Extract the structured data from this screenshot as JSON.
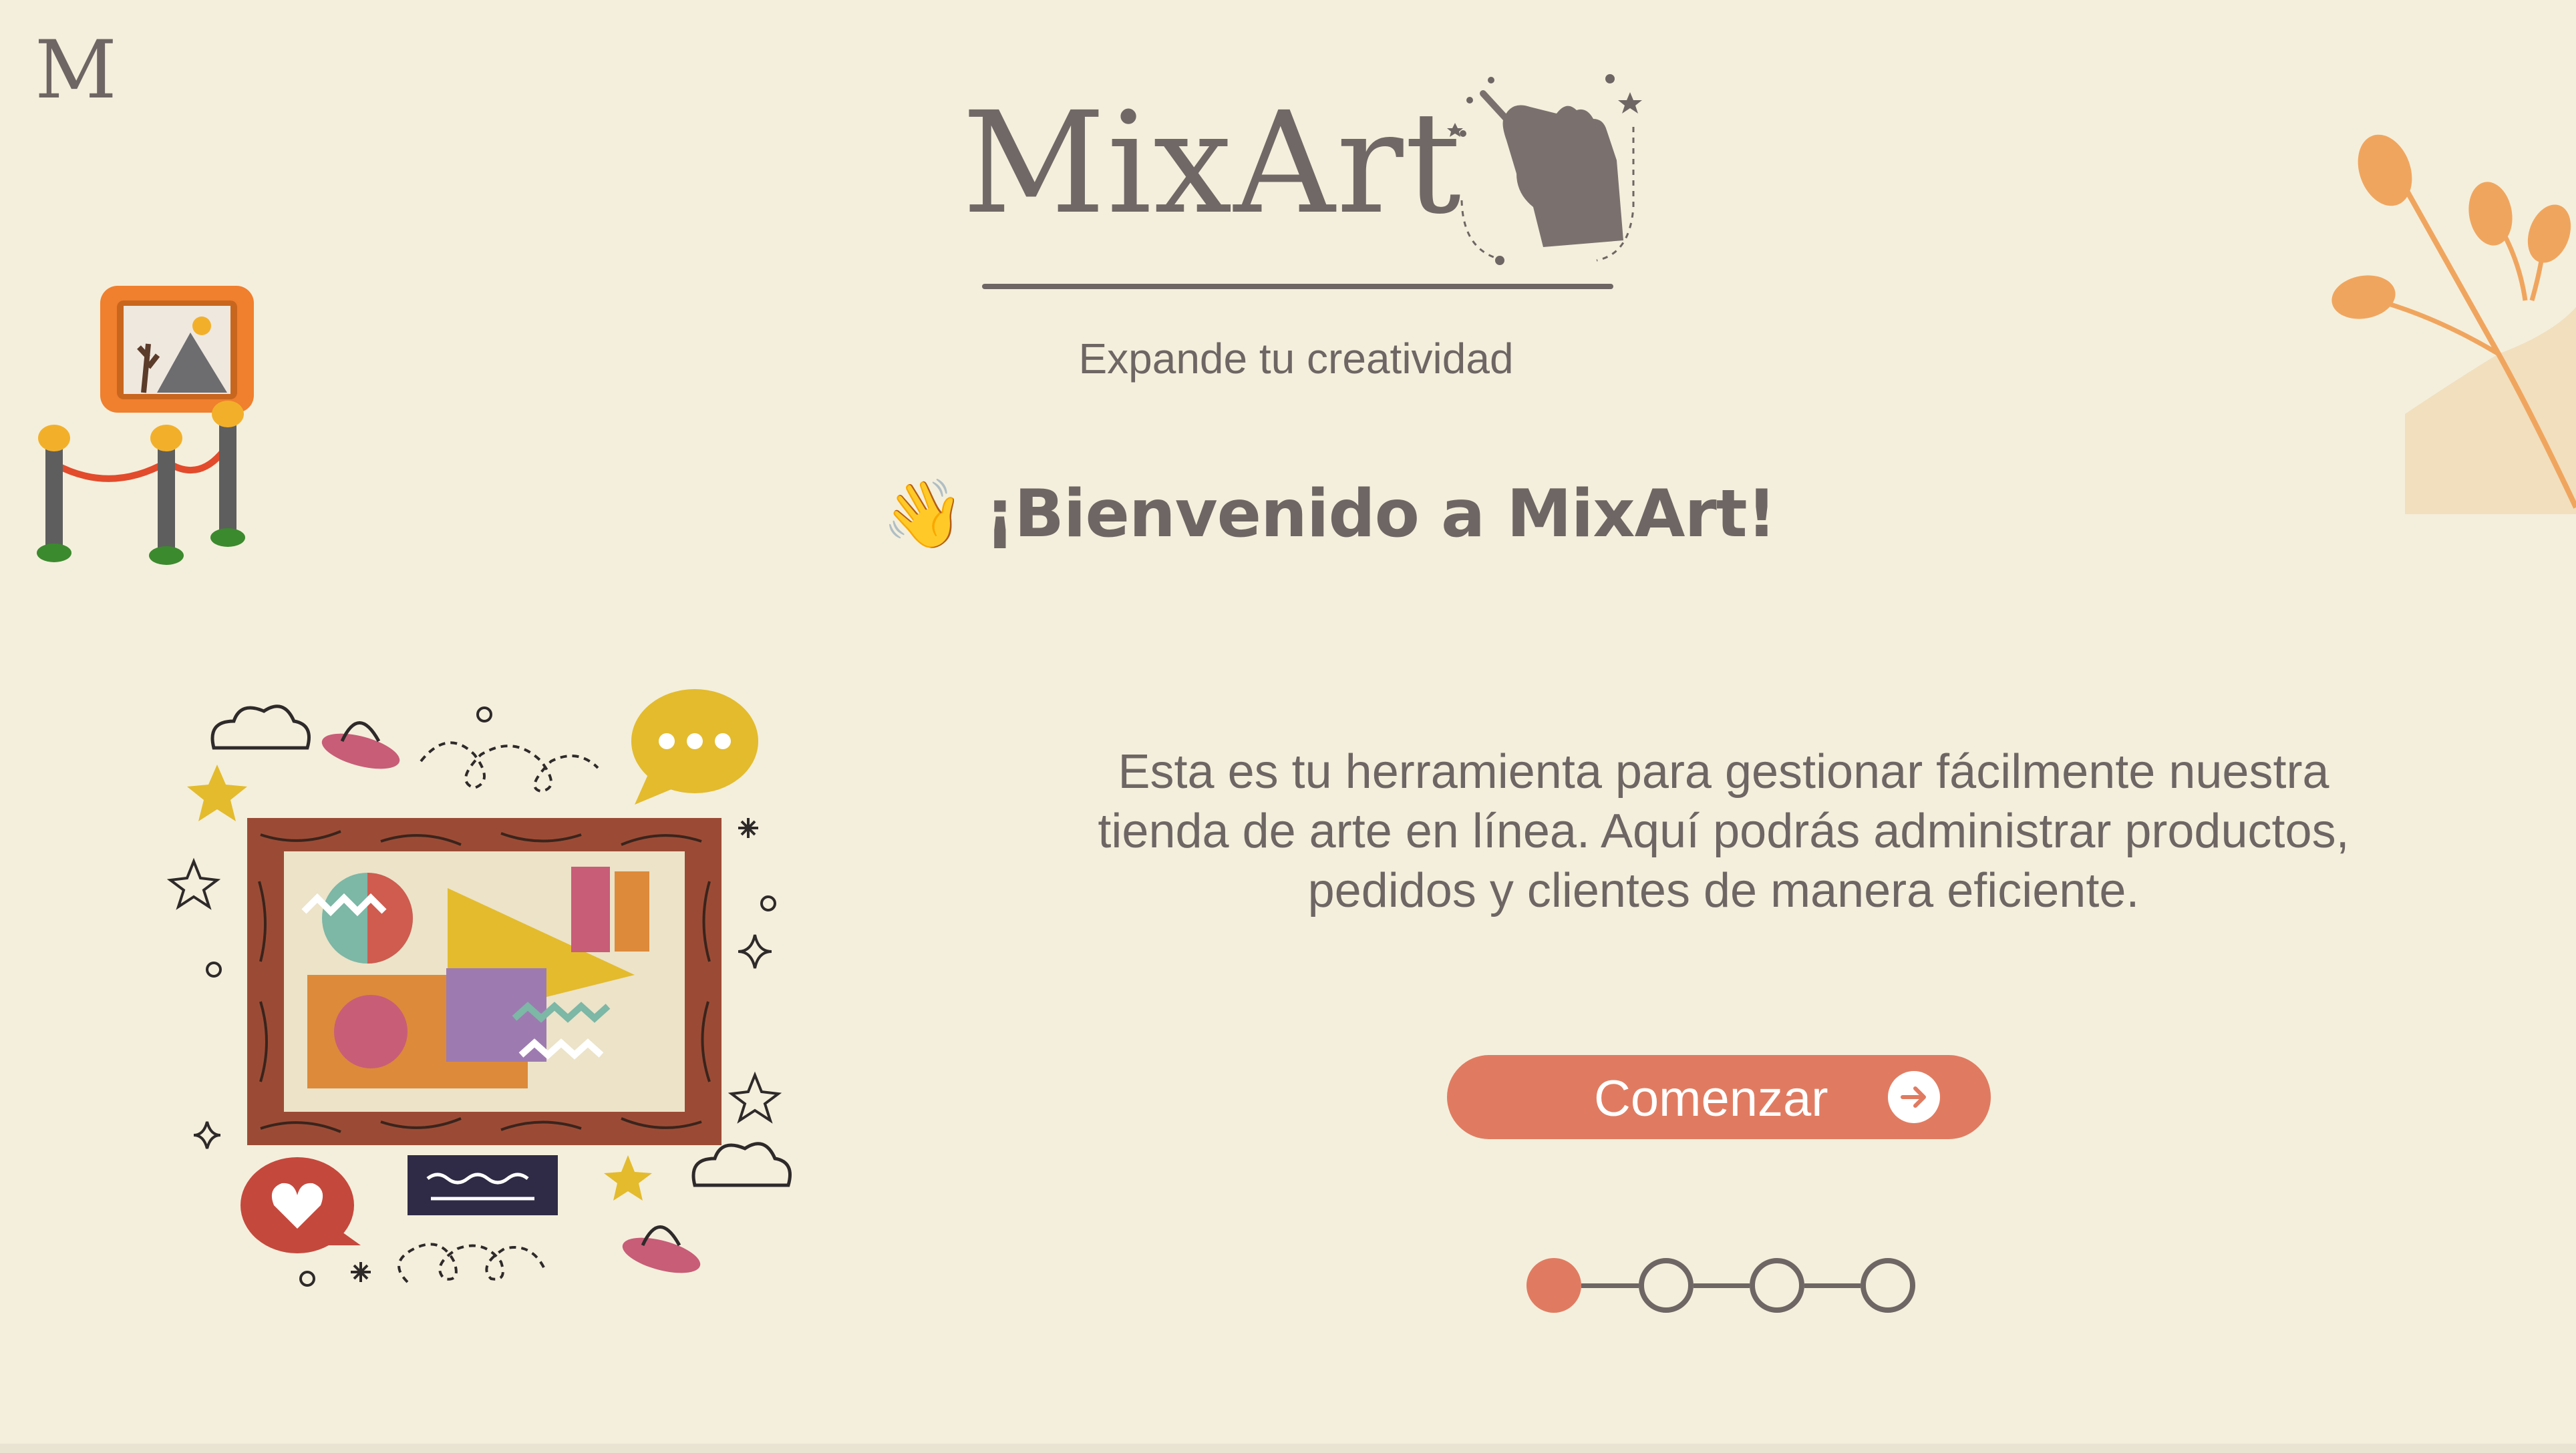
{
  "app": {
    "corner_logo": "M",
    "brand_title": "MixArt",
    "tagline": "Expande tu creatividad"
  },
  "welcome": {
    "emoji": "👋",
    "heading": "¡Bienvenido a MixArt!"
  },
  "description": {
    "lines": [
      "Esta es tu herramienta para gestionar fácilmente nuestra",
      "tienda de arte en línea. Aquí podrás administrar productos,",
      "pedidos y clientes de manera eficiente."
    ]
  },
  "cta": {
    "label": "Comenzar",
    "icon": "arrow-right-circle-icon"
  },
  "stepper": {
    "total": 4,
    "current": 1
  },
  "colors": {
    "background": "#f4efdc",
    "text": "#6e6664",
    "accent": "#e07b61",
    "orange_decor": "#f0a55e"
  },
  "decorations": [
    "museum-frame-icon",
    "hand-drawing-icon",
    "orange-branch-icon",
    "art-collage-illustration"
  ]
}
